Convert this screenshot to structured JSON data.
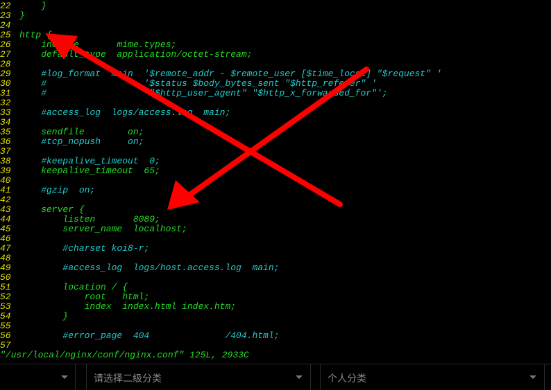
{
  "editor": {
    "lines": [
      {
        "n": "22",
        "segs": [
          {
            "t": "    }",
            "c": "g"
          }
        ]
      },
      {
        "n": "23",
        "segs": [
          {
            "t": "}",
            "c": "g"
          }
        ]
      },
      {
        "n": "24",
        "segs": []
      },
      {
        "n": "25",
        "segs": [
          {
            "t": "http {",
            "c": "g"
          }
        ]
      },
      {
        "n": "26",
        "segs": [
          {
            "t": "    include       mime.types;",
            "c": "g"
          }
        ]
      },
      {
        "n": "27",
        "segs": [
          {
            "t": "    default_type  application/octet-stream;",
            "c": "g"
          }
        ]
      },
      {
        "n": "28",
        "segs": []
      },
      {
        "n": "29",
        "segs": [
          {
            "t": "    #log_format  main  '$remote_addr - $remote_user [$time_local] \"$request\" '",
            "c": "c"
          }
        ]
      },
      {
        "n": "30",
        "segs": [
          {
            "t": "    #                  '$status $body_bytes_sent \"$http_referer\" '",
            "c": "c"
          }
        ]
      },
      {
        "n": "31",
        "segs": [
          {
            "t": "    #                  '\"$http_user_agent\" \"$http_x_forwarded_for\"';",
            "c": "c"
          }
        ]
      },
      {
        "n": "32",
        "segs": []
      },
      {
        "n": "33",
        "segs": [
          {
            "t": "    #access_log  logs/access.log  main;",
            "c": "c"
          }
        ]
      },
      {
        "n": "34",
        "segs": []
      },
      {
        "n": "35",
        "segs": [
          {
            "t": "    sendfile        on;",
            "c": "g"
          }
        ]
      },
      {
        "n": "36",
        "segs": [
          {
            "t": "    #tcp_nopush     on;",
            "c": "c"
          }
        ]
      },
      {
        "n": "37",
        "segs": []
      },
      {
        "n": "38",
        "segs": [
          {
            "t": "    #keepalive_timeout  0;",
            "c": "c"
          }
        ]
      },
      {
        "n": "39",
        "segs": [
          {
            "t": "    keepalive_timeout  65;",
            "c": "g"
          }
        ]
      },
      {
        "n": "40",
        "segs": []
      },
      {
        "n": "41",
        "segs": [
          {
            "t": "    #gzip  on;",
            "c": "c"
          }
        ]
      },
      {
        "n": "42",
        "segs": []
      },
      {
        "n": "43",
        "segs": [
          {
            "t": "    server {",
            "c": "g"
          }
        ]
      },
      {
        "n": "44",
        "segs": [
          {
            "t": "        listen       8089;",
            "c": "g"
          }
        ]
      },
      {
        "n": "45",
        "segs": [
          {
            "t": "        server_name  localhost;",
            "c": "g"
          }
        ]
      },
      {
        "n": "46",
        "segs": []
      },
      {
        "n": "47",
        "segs": [
          {
            "t": "        #charset koi8-r;",
            "c": "c"
          }
        ]
      },
      {
        "n": "48",
        "segs": []
      },
      {
        "n": "49",
        "segs": [
          {
            "t": "        #access_log  logs/host.access.log  main;",
            "c": "c"
          }
        ]
      },
      {
        "n": "50",
        "segs": []
      },
      {
        "n": "51",
        "segs": [
          {
            "t": "        location / {",
            "c": "g"
          }
        ]
      },
      {
        "n": "52",
        "segs": [
          {
            "t": "            root   html;",
            "c": "g"
          }
        ]
      },
      {
        "n": "53",
        "segs": [
          {
            "t": "            index  index.html index.htm;",
            "c": "g"
          }
        ]
      },
      {
        "n": "54",
        "segs": [
          {
            "t": "        }",
            "c": "g"
          }
        ]
      },
      {
        "n": "55",
        "segs": []
      },
      {
        "n": "56",
        "segs": [
          {
            "t": "        #error_page  404              /404.html;",
            "c": "c"
          }
        ]
      },
      {
        "n": "57",
        "segs": []
      }
    ],
    "status_line": "\"/usr/local/nginx/conf/nginx.conf\" 125L, 2933C"
  },
  "bottom_bar": {
    "secondary_category_placeholder": "请选择二级分类",
    "personal_category": "个人分类"
  },
  "annotation": {
    "color": "#ff0000"
  }
}
